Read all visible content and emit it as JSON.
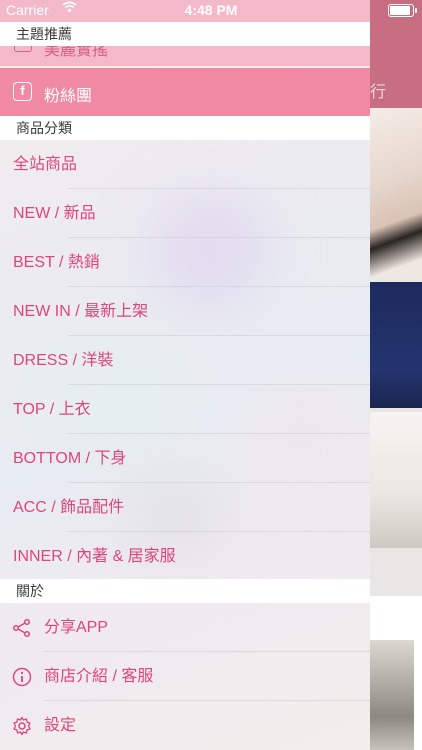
{
  "status_bar": {
    "carrier": "Carrier",
    "time": "4:48 PM",
    "battery_level": 0.95
  },
  "drawer": {
    "top_item_label": "美麗實搖",
    "sections": {
      "themes_header": "主題推薦",
      "categories_header": "商品分類",
      "about_header": "關於"
    },
    "fan_page_label": "粉絲團",
    "categories": [
      "全站商品",
      "NEW / 新品",
      "BEST / 熱銷",
      "NEW  IN / 最新上架",
      "DRESS / 洋裝",
      "TOP / 上衣",
      "BOTTOM / 下身",
      "ACC /  飾品配件",
      "INNER / 內著 & 居家服"
    ],
    "about": [
      {
        "icon": "share-icon",
        "label": "分享APP"
      },
      {
        "icon": "info-icon",
        "label": "商店介紹 / 客服"
      },
      {
        "icon": "gear-icon",
        "label": "設定"
      }
    ]
  },
  "background": {
    "header_partial_text": "行"
  },
  "colors": {
    "accent": "#e0457a",
    "selected_row": "#f08aa4",
    "header_bg": "#c86e83"
  }
}
